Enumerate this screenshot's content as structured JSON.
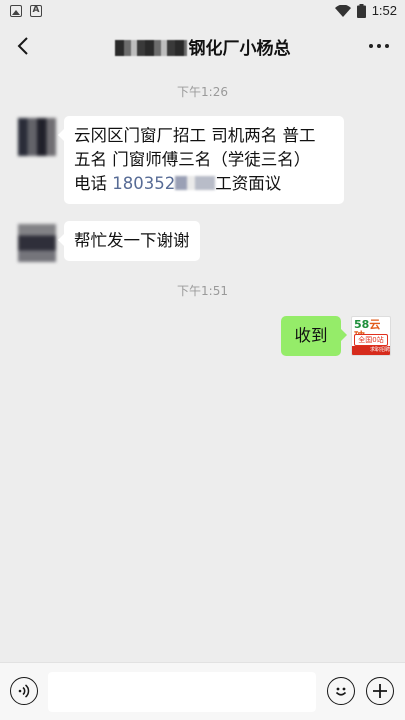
{
  "status_bar": {
    "time": "1:52",
    "icons": [
      "image-icon",
      "font-icon",
      "wifi-icon",
      "battery-icon"
    ]
  },
  "nav": {
    "title_visible": "钢化厂小杨总",
    "back_icon": "chevron-left-icon",
    "more_icon": "more-dots-icon"
  },
  "chat": {
    "timestamps": [
      "下午1:26",
      "下午1:51"
    ],
    "messages": [
      {
        "sender": "contact",
        "lines": [
          "云冈区门窗厂招工 司机两名 普工",
          "五名 门窗师傅三名（学徒三名）"
        ],
        "line3_prefix": "电话 ",
        "phone": "180352",
        "line3_suffix": "工资面议"
      },
      {
        "sender": "contact",
        "text": "帮忙发一下谢谢"
      },
      {
        "sender": "me",
        "text": "收到"
      }
    ],
    "my_avatar": {
      "brand_num": "58",
      "brand_text": "云玻",
      "badge_text": "全国0站",
      "footer_text": "求职招聘"
    }
  },
  "input_bar": {
    "voice_icon": "voice-icon",
    "emoji_icon": "emoji-icon",
    "plus_icon": "plus-icon",
    "input_value": ""
  },
  "colors": {
    "background": "#ededed",
    "my_bubble": "#95ec69",
    "their_bubble": "#ffffff",
    "link": "#576b95"
  }
}
